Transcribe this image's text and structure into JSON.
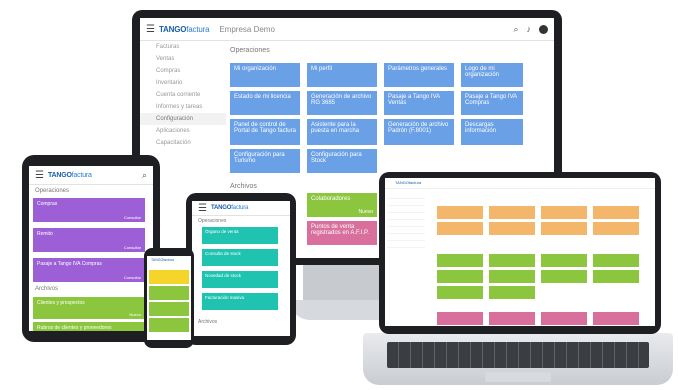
{
  "brand": {
    "logo": "TANGO",
    "logo_suffix": "factura",
    "company": "Empresa Demo"
  },
  "monitor": {
    "sidebar": [
      "Facturas",
      "Ventas",
      "Compras",
      "Inventario",
      "Cuenta corriente",
      "Informes y tareas",
      "Configuración",
      "Aplicaciones",
      "Capacitación"
    ],
    "section_operaciones": "Operaciones",
    "section_archivos": "Archivos",
    "tiles": [
      "Mi organización",
      "Mi perfil",
      "Parámetros generales",
      "Logo de mi organización",
      "Estado de mi licencia",
      "Generación de archivo RG 3685",
      "Pasaje a Tango IVA Ventas",
      "Pasaje a Tango IVA Compras",
      "Panel de control de Portal de Tango factura",
      "Asistente para la puesta en marcha",
      "Generación de archivo Padrón (F.8001)",
      "Descargas información",
      "Configuración para Turismo",
      "Configuración para Stock"
    ],
    "green_tile": {
      "label": "Colaboradores",
      "action": "Nuevo"
    },
    "pink_tile": "Puntos de venta registrados en A.F.I.P."
  },
  "tablet": {
    "section_operaciones": "Operaciones",
    "section_archivos": "Archivos",
    "purple_tiles": [
      "Compras",
      "Remito",
      "Pasaje a Tango IVA Compras"
    ],
    "action_label": "Consultar",
    "green_tiles": [
      "Clientes y prospectos",
      "Rubros de clientes y proveedores"
    ],
    "green_action": "Nuevo"
  },
  "smtab": {
    "section_operaciones": "Operaciones",
    "section_archivos": "Archivos",
    "tiles": [
      "Órgano de venta",
      "Consulta de stock",
      "Novedad de stock",
      "Facturación masiva"
    ],
    "action_label": "Consultar"
  }
}
